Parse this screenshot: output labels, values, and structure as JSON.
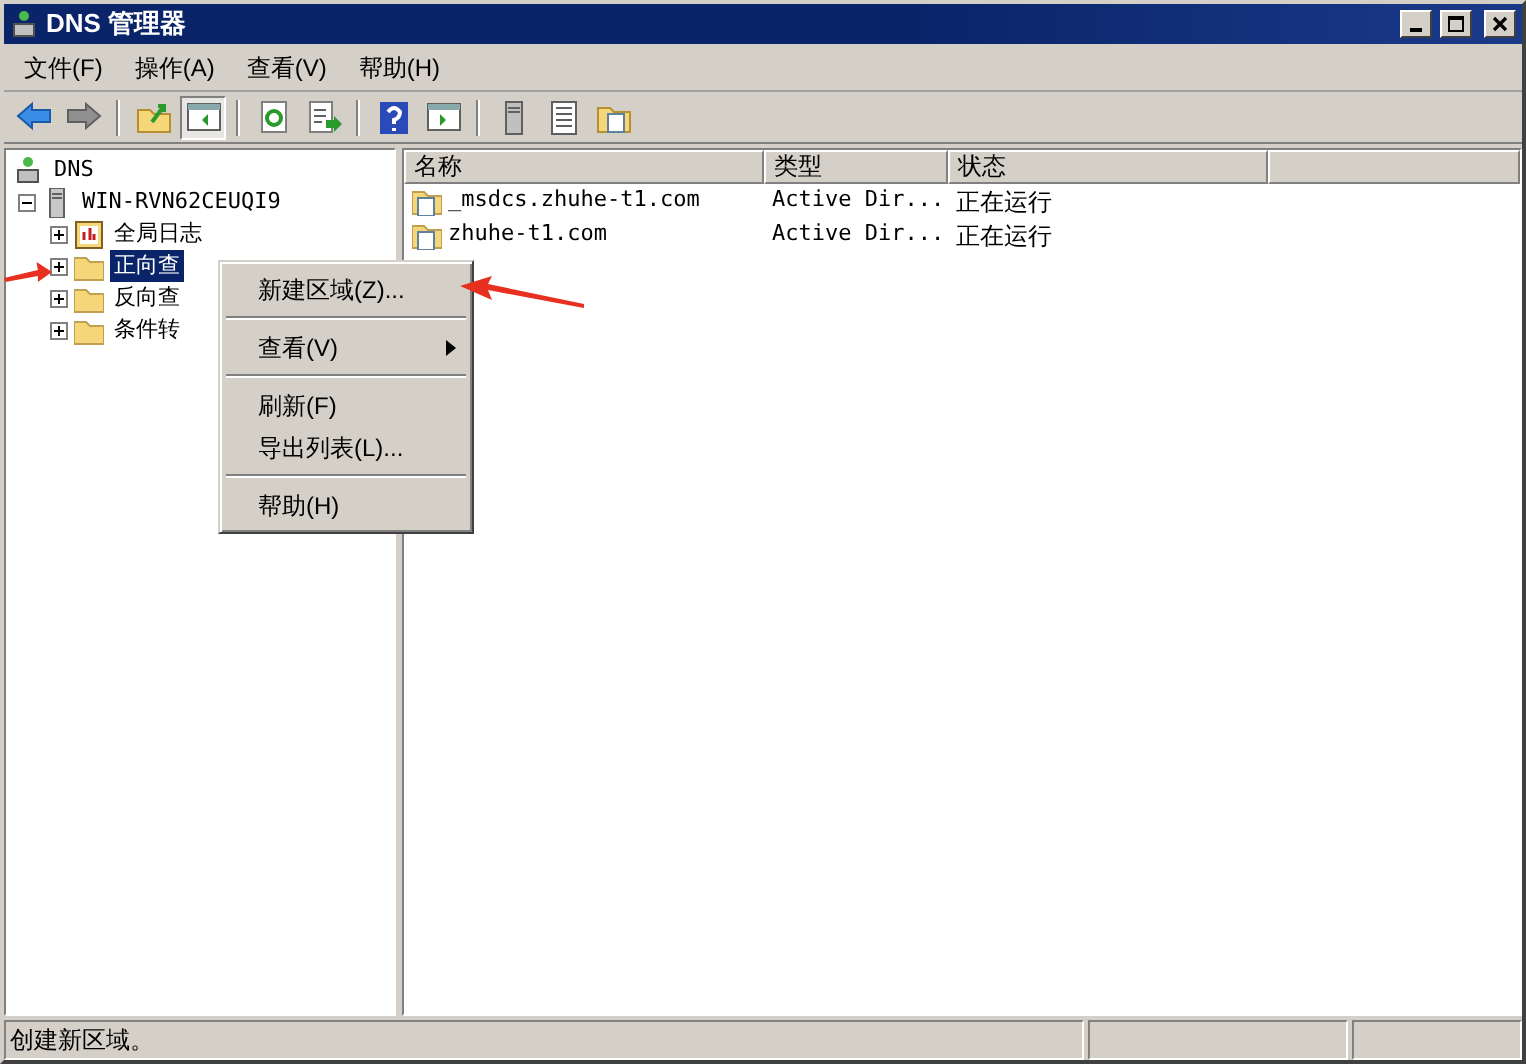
{
  "window": {
    "title": "DNS 管理器"
  },
  "menu_bar": [
    "文件(F)",
    "操作(A)",
    "查看(V)",
    "帮助(H)"
  ],
  "toolbar": [
    {
      "kind": "back",
      "pressed": false
    },
    {
      "kind": "forward",
      "pressed": false
    },
    {
      "kind": "sep"
    },
    {
      "kind": "up",
      "pressed": false
    },
    {
      "kind": "tree",
      "pressed": true
    },
    {
      "kind": "sep"
    },
    {
      "kind": "refresh",
      "pressed": false
    },
    {
      "kind": "export",
      "pressed": false
    },
    {
      "kind": "sep"
    },
    {
      "kind": "help",
      "pressed": false
    },
    {
      "kind": "pane",
      "pressed": false
    },
    {
      "kind": "sep"
    },
    {
      "kind": "server",
      "pressed": false
    },
    {
      "kind": "list",
      "pressed": false
    },
    {
      "kind": "folderdoc",
      "pressed": false
    }
  ],
  "tree": [
    {
      "label": "DNS",
      "selected": false,
      "children": [
        {
          "label": "WIN-RVN62CEUQI9",
          "expanded": true,
          "selected": false,
          "children": [
            {
              "label": "全局日志",
              "expanded": false,
              "selected": false
            },
            {
              "label": "正向查",
              "expanded": false,
              "selected": true
            },
            {
              "label": "反向查",
              "expanded": false,
              "selected": false
            },
            {
              "label": "条件转",
              "expanded": false,
              "selected": false
            }
          ]
        }
      ]
    }
  ],
  "table": {
    "columns": [
      "名称",
      "类型",
      "状态"
    ],
    "rows": [
      [
        "_msdcs.zhuhe-t1.com",
        "Active Dir...",
        "正在运行"
      ],
      [
        "zhuhe-t1.com",
        "Active Dir...",
        "正在运行"
      ]
    ]
  },
  "context_menu": [
    {
      "kind": "item",
      "label": "新建区域(Z)...",
      "submenu": false
    },
    {
      "kind": "sep"
    },
    {
      "kind": "item",
      "label": "查看(V)",
      "submenu": true
    },
    {
      "kind": "sep"
    },
    {
      "kind": "item",
      "label": "刷新(F)",
      "submenu": false
    },
    {
      "kind": "item",
      "label": "导出列表(L)...",
      "submenu": false
    },
    {
      "kind": "sep"
    },
    {
      "kind": "item",
      "label": "帮助(H)",
      "submenu": false
    }
  ],
  "status_bar": "创建新区域。"
}
